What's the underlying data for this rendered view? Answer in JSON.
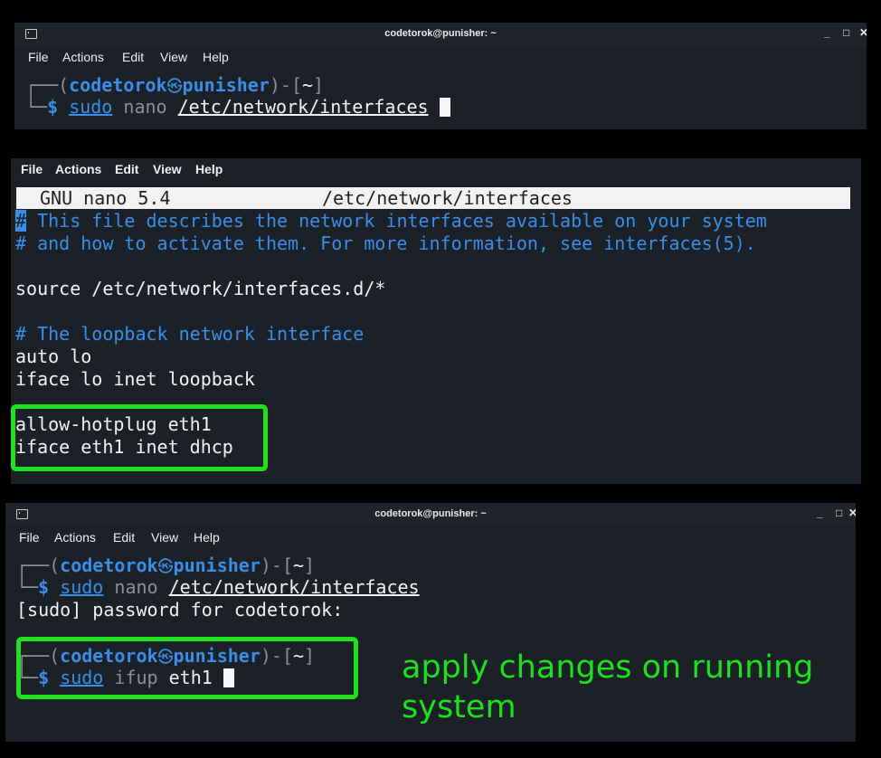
{
  "top_terminal": {
    "title": "codetorok@punisher: ~",
    "menu": [
      "File",
      "Actions",
      "Edit",
      "View",
      "Help"
    ],
    "prompt": {
      "user": "codetorok",
      "symbol": "㉿",
      "host": "punisher",
      "dir": "~"
    },
    "command": {
      "sudo": "sudo",
      "cmd": "nano",
      "arg": "/etc/network/interfaces"
    }
  },
  "nano": {
    "menu": [
      "File",
      "Actions",
      "Edit",
      "View",
      "Help"
    ],
    "header_app": "GNU nano 5.4",
    "header_file": "/etc/network/interfaces",
    "comment_1_hash": "#",
    "comment_1_text": " This file describes the network interfaces available on your system",
    "comment_2": "# and how to activate them. For more information, see interfaces(5).",
    "source_line": "source /etc/network/interfaces.d/*",
    "comment_3": "# The loopback network interface",
    "auto_line": "auto lo",
    "iface_lo": "iface lo inet loopback",
    "allow_line": "allow-hotplug eth1",
    "iface_eth1": "iface eth1 inet dhcp"
  },
  "bottom_terminal": {
    "title": "codetorok@punisher: ~",
    "menu": [
      "File",
      "Actions",
      "Edit",
      "View",
      "Help"
    ],
    "prompt": {
      "user": "codetorok",
      "symbol": "㉿",
      "host": "punisher",
      "dir": "~"
    },
    "command1": {
      "sudo": "sudo",
      "cmd": "nano",
      "arg": "/etc/network/interfaces"
    },
    "password_prompt": "[sudo] password for codetorok:",
    "command2": {
      "sudo": "sudo",
      "cmd": "ifup",
      "arg": "eth1"
    }
  },
  "annotation": {
    "line1": "apply changes on running",
    "line2": "system"
  },
  "window_controls": {
    "minimize": "_",
    "maximize": "□",
    "close": "✕"
  }
}
